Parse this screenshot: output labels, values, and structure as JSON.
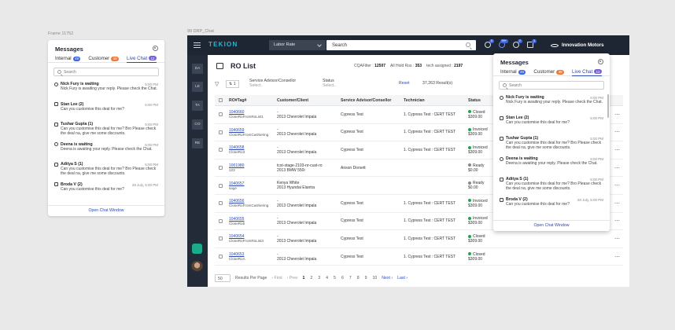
{
  "frames": {
    "left_label": "Frame 11752",
    "right_label": "99 DRP_Chat"
  },
  "messages": {
    "title": "Messages",
    "tabs": [
      {
        "label": "Internal",
        "count": "49",
        "color": "#3c66e8"
      },
      {
        "label": "Customer",
        "count": "39",
        "color": "#f07a3a"
      },
      {
        "label": "Live Chat",
        "count": "12",
        "color": "#7a63d8"
      }
    ],
    "search_placeholder": "Search",
    "items": [
      {
        "name": "Nick Fury is waiting",
        "time": "5:00 PM",
        "text": "Nick Fury is awaiting your reply. Please check the Chat.",
        "icon": "clock-icon"
      },
      {
        "name": "Stan Lee (2)",
        "time": "5:00 PM",
        "text": "Can you customise this deal for me?",
        "icon": "chat-icon"
      },
      {
        "name": "Tushar Gupta (1)",
        "time": "5:00 PM",
        "text": "Can you customise this deal for me? Bro Please check the deal na, give me some discounts.",
        "icon": "chat-icon"
      },
      {
        "name": "Deena is waiting",
        "time": "5:00 PM",
        "text": "Deena is awaiting your reply. Please check the Chat.",
        "icon": "clock-icon"
      },
      {
        "name": "Aditya S (1)",
        "time": "5:00 PM",
        "text": "Can you customise this deal for me? Bro Please check the deal na, give me some discounts.",
        "icon": "chat-icon"
      },
      {
        "name": "Broda V (2)",
        "time": "28 July, 5:00 PM",
        "text": "Can you customise this deal for me?",
        "icon": "chat-icon"
      }
    ],
    "open_chat": "Open Chat Window"
  },
  "app": {
    "logo": "TEKION",
    "labor_rate": "Labor Rate",
    "search": "Search",
    "brand": "Innovation Motors",
    "toolbar_badges": [
      "5",
      "99+",
      "2",
      "3"
    ],
    "sidenav": [
      "DA",
      "LE",
      "TA",
      "CO",
      "RE"
    ],
    "page_title": "RO List",
    "stats": [
      {
        "label": "CQAFilter",
        "value": "12507"
      },
      {
        "label": "All Hold Ros",
        "value": "353"
      },
      {
        "label": "tech assigned",
        "value": "2197"
      }
    ],
    "filters": {
      "sort_label": "1",
      "advisor_label": "Service Advisor/Consellor",
      "advisor_placeholder": "Select..",
      "status_label": "Status",
      "status_placeholder": "Select..",
      "reset": "Reset",
      "results": "37,263 Result(s)"
    },
    "columns": [
      "RO#Tag#",
      "Customer/Client",
      "Service Advisor/Consellor",
      "Technician",
      "Status"
    ],
    "rows": [
      {
        "ro": "1040660",
        "tag": "CloseRoFromRoList1",
        "customer": "- ",
        "vehicle": "2013 Chevrolet Impala",
        "advisor": "Cypress Test",
        "tech": "1. Cypress Test : CERT TEST",
        "status": "Closed",
        "amount": "$309.00",
        "color": "#1aa84a"
      },
      {
        "ro": "1040659",
        "tag": "CloseRoFromCashiering",
        "customer": "- ",
        "vehicle": "2013 Chevrolet Impala",
        "advisor": "Cypress Test",
        "tech": "1. Cypress Test : CERT TEST",
        "status": "Invoiced",
        "amount": "$309.00",
        "color": "#1aa84a"
      },
      {
        "ro": "1040658",
        "tag": "CloseRo3",
        "customer": "- ",
        "vehicle": "2013 Chevrolet Impala",
        "advisor": "Cypress Test",
        "tech": "1. Cypress Test : CERT TEST",
        "status": "Invoiced",
        "amount": "$309.00",
        "color": "#1aa84a"
      },
      {
        "ro": "1001980",
        "tag": "123",
        "customer": "tcst-stage-2103-nr-cust-ro",
        "vehicle": "2013 BMW 550i",
        "advisor": "Anson Dorsett",
        "tech": "",
        "status": "Ready",
        "amount": "$0.00",
        "color": "#888888"
      },
      {
        "ro": "1040657",
        "tag": "sage",
        "customer": "Kenya White",
        "vehicle": "2013 Hyundai Elantra",
        "advisor": "",
        "tech": "",
        "status": "Ready",
        "amount": "$0.00",
        "color": "#888888"
      },
      {
        "ro": "1040656",
        "tag": "CloseRoFromCashiering",
        "customer": "- ",
        "vehicle": "2013 Chevrolet Impala",
        "advisor": "Cypress Test",
        "tech": "1. Cypress Test : CERT TEST",
        "status": "Invoiced",
        "amount": "$309.00",
        "color": "#1aa84a"
      },
      {
        "ro": "1040655",
        "tag": "CloseRob",
        "customer": "- ",
        "vehicle": "2013 Chevrolet Impala",
        "advisor": "Cypress Test",
        "tech": "1. Cypress Test : CERT TEST",
        "status": "Invoiced",
        "amount": "$309.00",
        "color": "#1aa84a"
      },
      {
        "ro": "1040654",
        "tag": "CloseRoFromRoList3",
        "customer": "- ",
        "vehicle": "2013 Chevrolet Impala",
        "advisor": "Cypress Test",
        "tech": "1. Cypress Test : CERT TEST",
        "status": "Closed",
        "amount": "$309.00",
        "color": "#1aa84a"
      },
      {
        "ro": "1040653",
        "tag": "CloseRoA",
        "customer": "- ",
        "vehicle": "2013 Chevrolet Impala",
        "advisor": "Cypress Test",
        "tech": "1. Cypress Test : CERT TEST",
        "status": "Closed",
        "amount": "$309.00",
        "color": "#1aa84a"
      }
    ],
    "pager": {
      "page_size": "50",
      "results_label": "Results Per Page",
      "first": "First",
      "prev": "Prev",
      "pages": [
        "1",
        "2",
        "3",
        "4",
        "5",
        "6",
        "7",
        "8",
        "9",
        "10"
      ],
      "next": "Next",
      "last": "Last"
    }
  }
}
